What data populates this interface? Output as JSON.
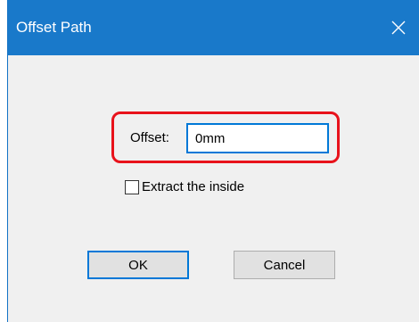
{
  "dialog": {
    "title": "Offset Path",
    "close_icon": "close-icon"
  },
  "offset": {
    "label": "Offset:",
    "value": "0mm"
  },
  "extract_inside": {
    "label": "Extract the inside",
    "checked": false
  },
  "buttons": {
    "ok_label": "OK",
    "cancel_label": "Cancel"
  },
  "colors": {
    "titlebar": "#1979ca",
    "dialog_bg": "#f0f0f0",
    "highlight_annotation": "#e8121b",
    "focus_border": "#0078d7"
  }
}
